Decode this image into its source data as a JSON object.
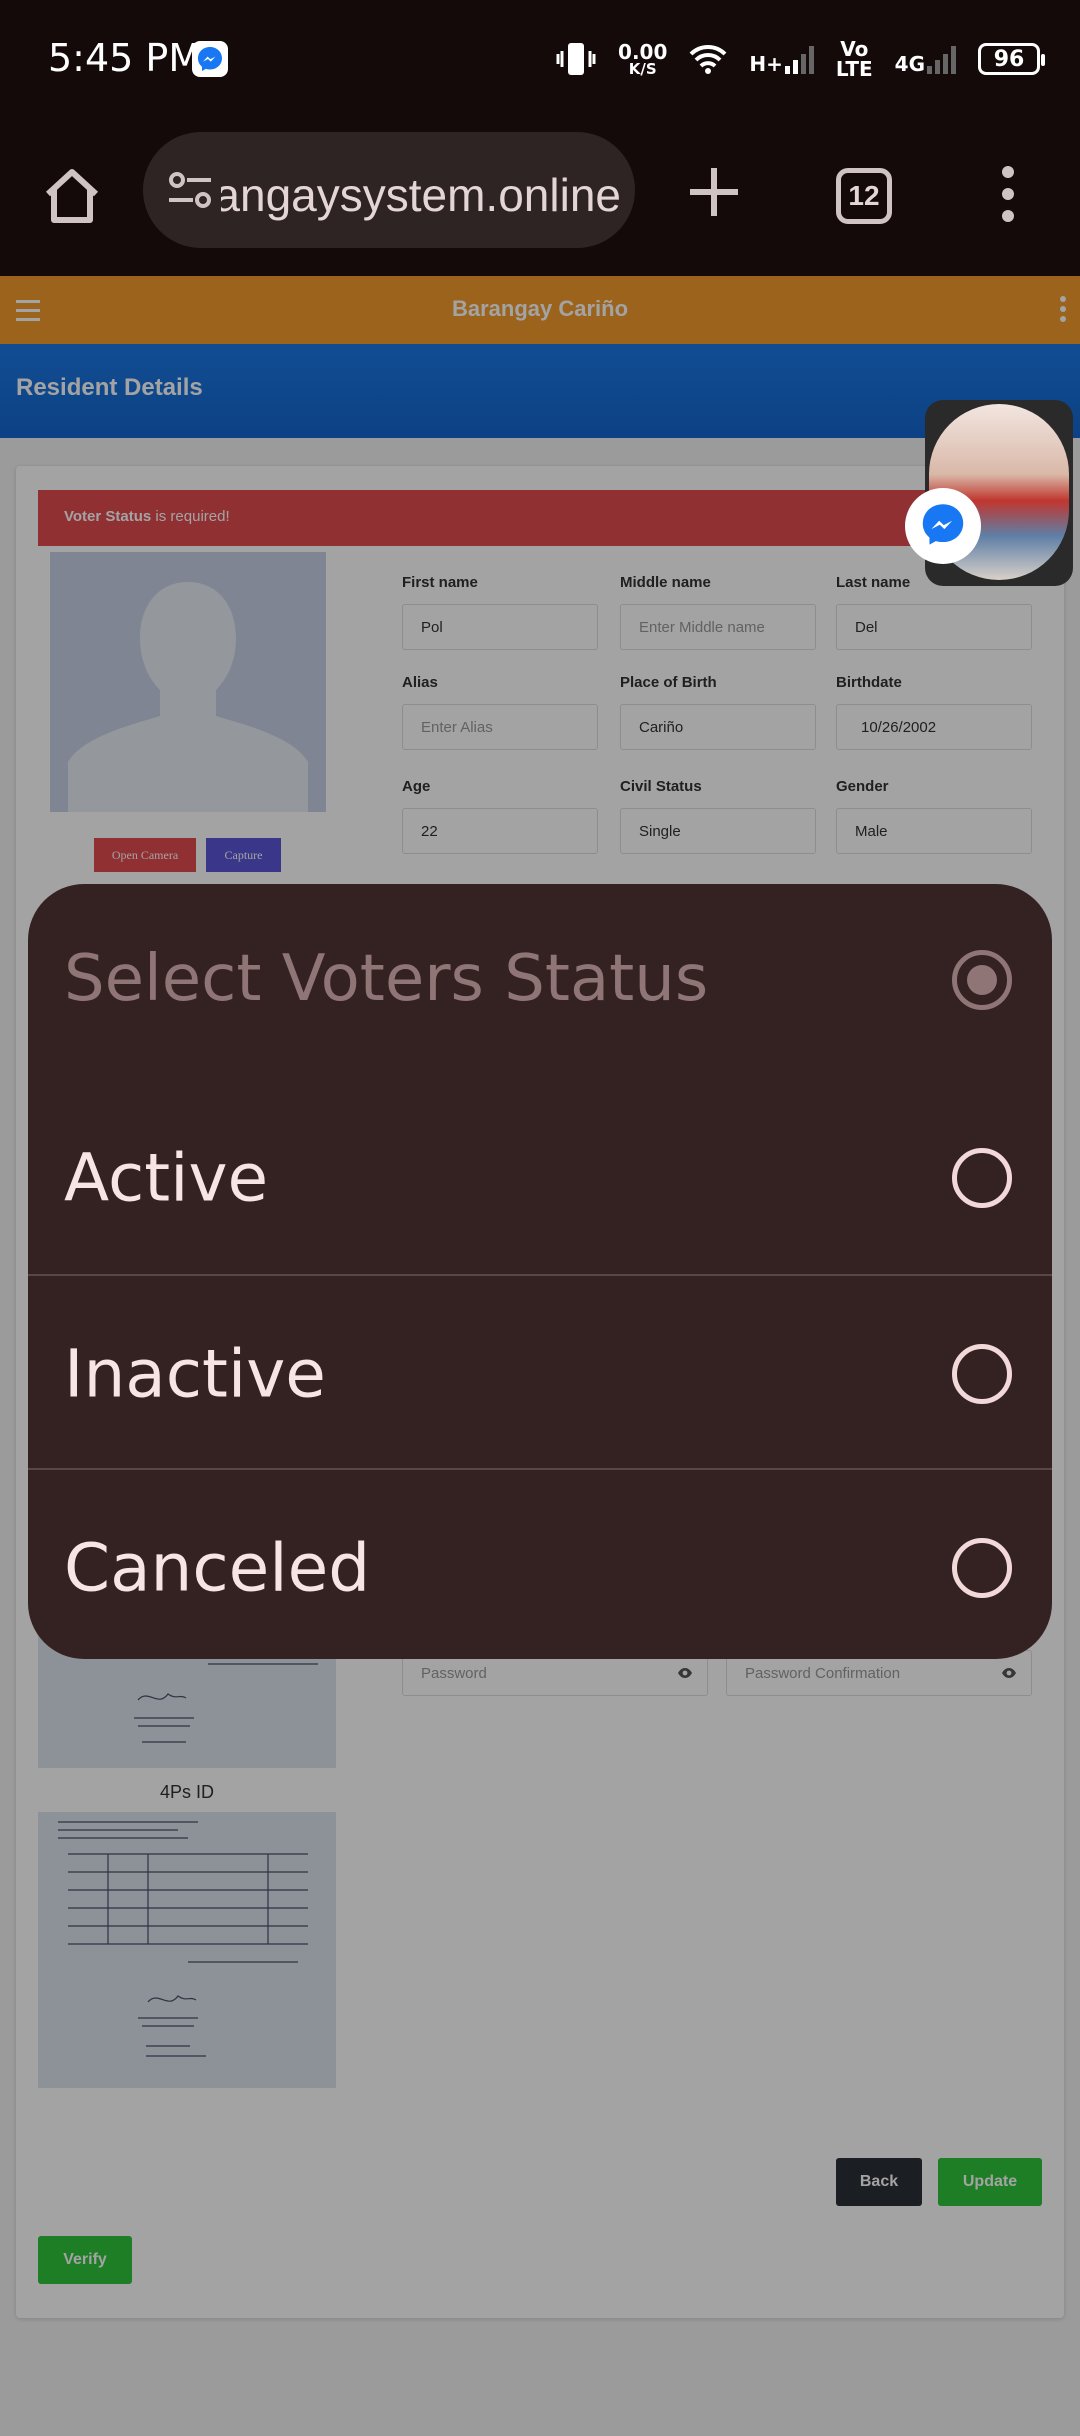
{
  "status_bar": {
    "time": "5:45 PM",
    "net_speed_value": "0.00",
    "net_speed_unit": "K/S",
    "network_label": "H+",
    "volte_label": "Vo\nLTE",
    "lte_label": "4G",
    "battery": "96"
  },
  "browser": {
    "url": "barangaysystem.online",
    "tab_count": "12"
  },
  "app": {
    "title": "Barangay Cariño",
    "page_heading": "Resident Details"
  },
  "alert": {
    "bold": "Voter Status",
    "rest": " is required!"
  },
  "photo_buttons": {
    "open_camera": "Open Camera",
    "capture": "Capture"
  },
  "form": {
    "first_name": {
      "label": "First name",
      "value": "Pol"
    },
    "middle_name": {
      "label": "Middle name",
      "placeholder": "Enter Middle name"
    },
    "last_name": {
      "label": "Last name",
      "value": "Del"
    },
    "alias": {
      "label": "Alias",
      "placeholder": "Enter Alias"
    },
    "place_of_birth": {
      "label": "Place of Birth",
      "value": "Cariño"
    },
    "birthdate": {
      "label": "Birthdate",
      "value": "10/26/2002"
    },
    "age": {
      "label": "Age",
      "value": "22"
    },
    "civil_status": {
      "label": "Civil Status",
      "value": "Single"
    },
    "gender": {
      "label": "Gender",
      "value": "Male"
    },
    "password": {
      "placeholder": "Password"
    },
    "password_confirmation": {
      "placeholder": "Password Confirmation"
    }
  },
  "documents": {
    "caption_1": "4Ps ID"
  },
  "actions": {
    "back": "Back",
    "update": "Update",
    "verify": "Verify"
  },
  "dialog": {
    "title": "Select Voters Status",
    "options": [
      {
        "label": "Active"
      },
      {
        "label": "Inactive"
      },
      {
        "label": "Canceled"
      }
    ]
  },
  "colors": {
    "header_orange": "#f39b2c",
    "banner_blue": "#1c78e6",
    "alert_red": "#e24b51",
    "dialog_bg": "#342222",
    "success_green": "#2fc53a"
  }
}
